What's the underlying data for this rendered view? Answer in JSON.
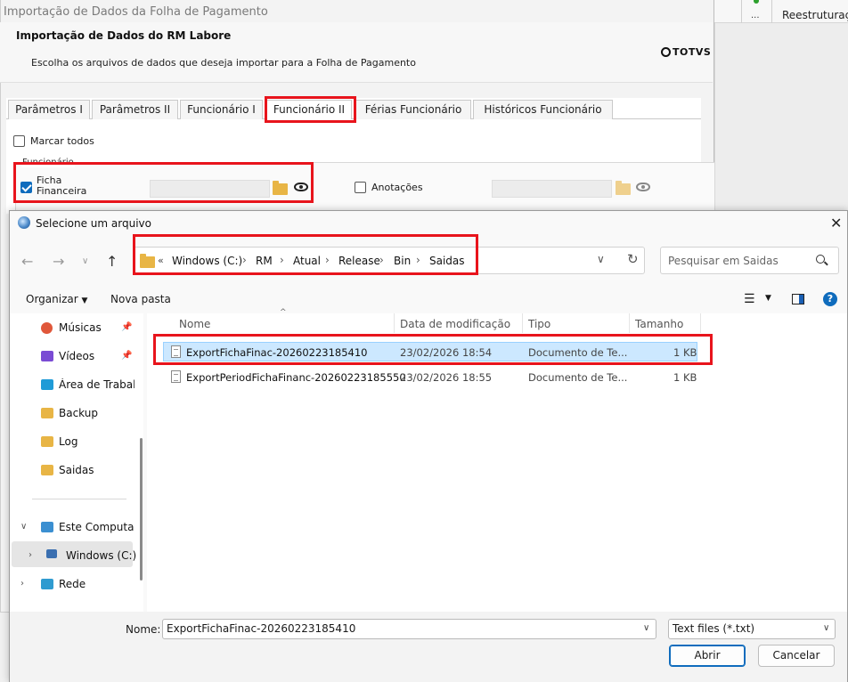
{
  "background_app": {
    "toolbar_dots": "...",
    "toolbar_item": "Reestruturação"
  },
  "import_window": {
    "title": "Importação de Dados da Folha de Pagamento",
    "heading": "Importação de Dados do RM Labore",
    "subtitle": "Escolha os arquivos de dados que deseja importar para a Folha de Pagamento",
    "brand": "TOTVS",
    "tabs": [
      {
        "label": "Parâmetros I"
      },
      {
        "label": "Parâmetros II"
      },
      {
        "label": "Funcionário I"
      },
      {
        "label": "Funcionário II"
      },
      {
        "label": "Férias Funcionário"
      },
      {
        "label": "Históricos Funcionário"
      }
    ],
    "active_tab": "Funcionário II",
    "select_all_label": "Marcar todos",
    "group_label": "Funcionário",
    "ficha_label": "Ficha Financeira",
    "ficha_checked": true,
    "anotacoes_label": "Anotações",
    "anotacoes_checked": false
  },
  "file_dialog": {
    "title": "Selecione um arquivo",
    "breadcrumb_overflow": "«",
    "breadcrumb": [
      "Windows (C:)",
      "RM",
      "Atual",
      "Release",
      "Bin",
      "Saidas"
    ],
    "search_placeholder": "Pesquisar em Saidas",
    "organize_label": "Organizar",
    "new_folder_label": "Nova pasta",
    "nav_items": [
      {
        "label": "Músicas",
        "pinned": true
      },
      {
        "label": "Vídeos",
        "pinned": true
      },
      {
        "label": "Área de Trabalho",
        "pinned": false
      },
      {
        "label": "Backup",
        "pinned": false
      },
      {
        "label": "Log",
        "pinned": false
      },
      {
        "label": "Saidas",
        "pinned": false
      },
      {
        "label": "Este Computador",
        "pinned": false
      },
      {
        "label": "Windows (C:)",
        "pinned": false
      },
      {
        "label": "Rede",
        "pinned": false
      }
    ],
    "columns": {
      "name": "Nome",
      "modified": "Data de modificação",
      "type": "Tipo",
      "size": "Tamanho"
    },
    "files": [
      {
        "name": "ExportFichaFinac-20260223185410",
        "modified": "23/02/2026 18:54",
        "type": "Documento de Te...",
        "size": "1 KB",
        "selected": true
      },
      {
        "name": "ExportPeriodFichaFinanc-20260223185550",
        "modified": "23/02/2026 18:55",
        "type": "Documento de Te...",
        "size": "1 KB",
        "selected": false
      }
    ],
    "filename_label": "Nome:",
    "filename_value": "ExportFichaFinac-20260223185410",
    "filetype_value": "Text files (*.txt)",
    "open_label": "Abrir",
    "cancel_label": "Cancelar"
  },
  "colors": {
    "highlight_red": "#e8141c",
    "selection_blue": "#cce8ff",
    "accent_blue": "#0f6cbd"
  }
}
